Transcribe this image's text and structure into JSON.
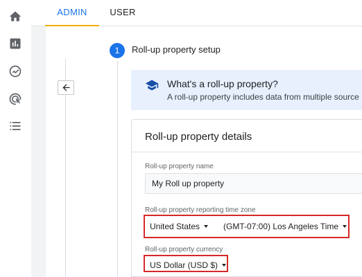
{
  "nav_rail": {
    "icons": [
      "home-icon",
      "reports-icon",
      "explore-icon",
      "advertising-icon",
      "configure-icon"
    ]
  },
  "tabs": {
    "admin": "ADMIN",
    "user": "USER"
  },
  "step": {
    "number": "1",
    "title": "Roll-up property setup"
  },
  "info": {
    "title": "What's a roll-up property?",
    "text": "A roll-up property includes data from multiple source"
  },
  "details": {
    "heading": "Roll-up property details",
    "name_label": "Roll-up property name",
    "name_value": "My Roll up property",
    "timezone_label": "Roll-up property reporting time zone",
    "country_value": "United States",
    "timezone_value": "(GMT-07:00) Los Angeles Time",
    "currency_label": "Roll-up property currency",
    "currency_value": "US Dollar (USD $)"
  },
  "colors": {
    "accent": "#1a73e8",
    "tab_indicator": "#f9ab00",
    "highlight": "#d62828",
    "info_bg": "#e8f0fe"
  }
}
